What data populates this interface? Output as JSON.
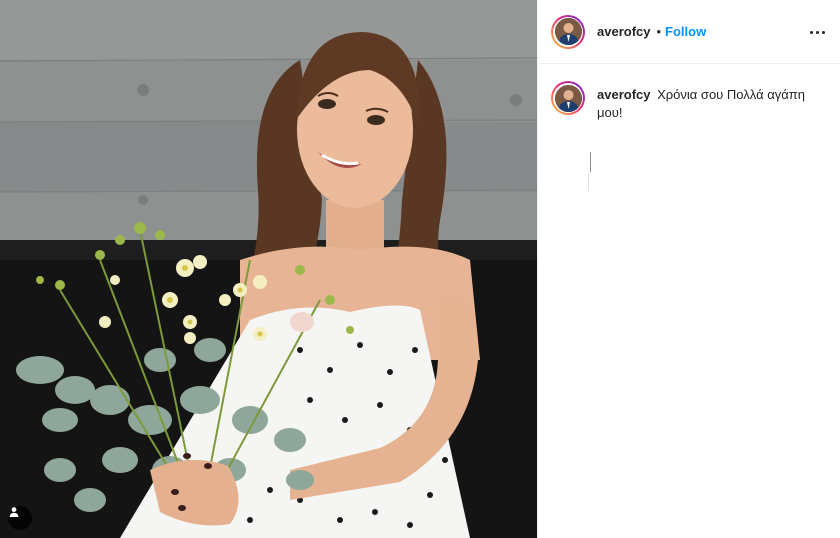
{
  "header": {
    "username": "averofcy",
    "separator": "•",
    "follow_label": "Follow",
    "more_icon": "more-horizontal-icon"
  },
  "caption": {
    "username": "averofcy",
    "text": "Χρόνια σου Πολλά αγάπη μου!"
  },
  "photo": {
    "tag_icon": "user-tag-icon"
  },
  "colors": {
    "follow_blue": "#0095f6",
    "text": "#262626",
    "border": "#efefef"
  }
}
